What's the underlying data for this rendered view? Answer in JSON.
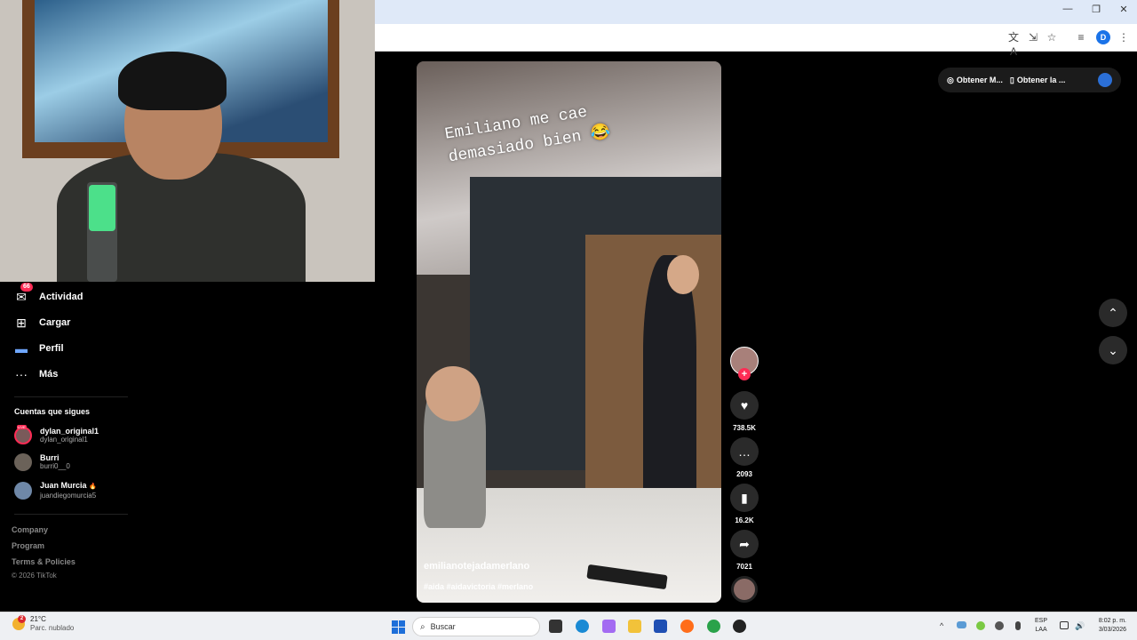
{
  "browser": {
    "window_controls": {
      "minimize": "—",
      "restore": "❐",
      "close": "✕"
    },
    "toolbar_icons": {
      "translate": "文A",
      "install": "⇲",
      "bookmark": "☆",
      "reading_list": "≡",
      "menu": "⋮"
    },
    "profile_initial": "D"
  },
  "sidebar": {
    "items": [
      {
        "label": "Actividad",
        "icon": "inbox-icon",
        "glyph": "✉",
        "badge": "66"
      },
      {
        "label": "Cargar",
        "icon": "upload-icon",
        "glyph": "⊞"
      },
      {
        "label": "Perfil",
        "icon": "profile-icon",
        "glyph": "▬"
      },
      {
        "label": "Más",
        "icon": "more-icon",
        "glyph": "···"
      }
    ],
    "following_title": "Cuentas que sigues",
    "following": [
      {
        "name": "dylan_original1",
        "handle": "dylan_original1",
        "live": "LIVE"
      },
      {
        "name": "Burri",
        "handle": "burri0__0"
      },
      {
        "name": "Juan Murcia",
        "handle": "juandiegomurcia5",
        "flame": "🔥"
      }
    ],
    "footer": {
      "company": "Company",
      "program": "Program",
      "terms": "Terms & Policies",
      "copyright": "© 2026 TikTok"
    }
  },
  "video": {
    "caption": "Emiliano me cae demasiado bien 😂",
    "author": "emilianotejadamerlano",
    "hashtags": "#aida #aidavictoria #merlano"
  },
  "actions": {
    "likes": "738.5K",
    "comments": "2093",
    "saves": "16.2K",
    "shares": "7021",
    "follow_plus": "+",
    "like_glyph": "♥",
    "comment_glyph": "…",
    "save_glyph": "▮",
    "share_glyph": "➦"
  },
  "topbar": {
    "get_coins": "Obtener M...",
    "get_app": "Obtener la ..."
  },
  "navigation": {
    "prev": "⌃",
    "next": "⌄"
  },
  "taskbar": {
    "weather_badge": "2",
    "temperature": "21°C",
    "weather_desc": "Parc. nublado",
    "search_placeholder": "Buscar",
    "lang_line1": "ESP",
    "lang_line2": "LAA",
    "time": "8:02 p. m.",
    "date": "3/03/2026",
    "tray_up": "^"
  }
}
